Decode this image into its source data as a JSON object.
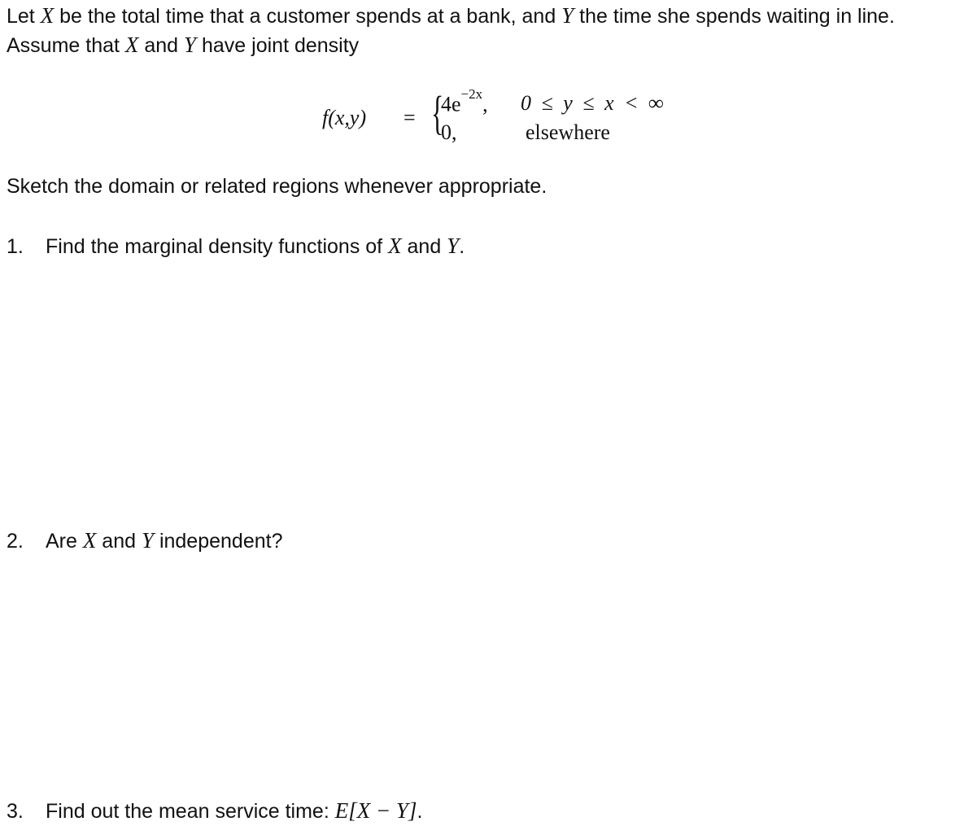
{
  "intro": {
    "line1": {
      "pre": "Let ",
      "var1": "X",
      "mid": " be the total time that a customer spends at a bank, and ",
      "var2": "Y",
      "post": " the time she spends waiting in line."
    },
    "line2": {
      "pre": "Assume that ",
      "var1": "X",
      "mid": " and ",
      "var2": "Y",
      "post": " have joint density"
    }
  },
  "formula": {
    "lhs_f": "f",
    "lhs_args": "(x,y)",
    "equals": "=",
    "brace": "{",
    "case1_value": "4e",
    "case1_exponent": "−2x",
    "case1_comma": ",",
    "case1_condition": "0 ≤ y ≤ x < ∞",
    "case2_value": "0,",
    "case2_condition": "elsewhere"
  },
  "instruction": "Sketch the domain or related regions whenever appropriate.",
  "questions": [
    {
      "number": "1.",
      "pre": "Find the marginal density functions of ",
      "var1": "X",
      "mid": " and ",
      "var2": "Y",
      "post": "."
    },
    {
      "number": "2.",
      "pre": "Are ",
      "var1": "X",
      "mid": " and ",
      "var2": "Y",
      "post": " independent?"
    },
    {
      "number": "3.",
      "pre": "Find out the mean service time: ",
      "expr": "E[X − Y]",
      "post": "."
    }
  ]
}
